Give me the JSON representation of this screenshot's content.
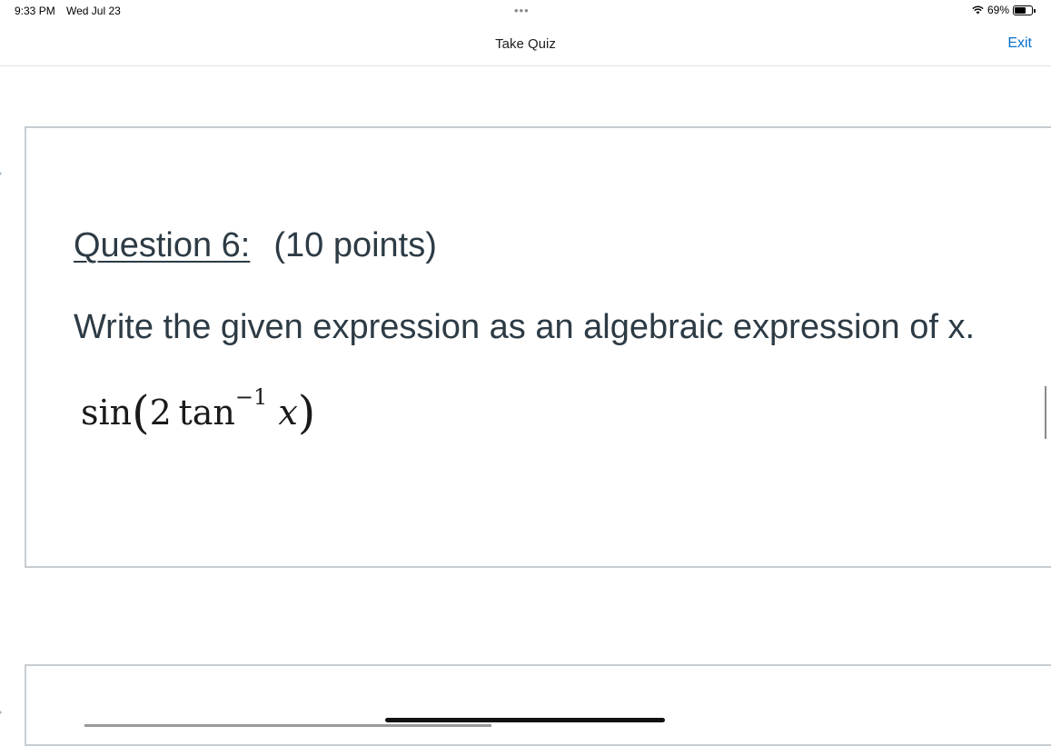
{
  "status_bar": {
    "time": "9:33 PM",
    "date": "Wed Jul 23",
    "battery": "69%",
    "battery_level": 0.69,
    "icons": [
      "wifi-icon",
      "battery-icon"
    ]
  },
  "nav": {
    "title": "Take Quiz",
    "exit_label": "Exit",
    "accent_color": "#0770cf"
  },
  "question": {
    "number_label": "Question 6:",
    "points_label": "(10 points)",
    "prompt": "Write the given expression as an algebraic expression of x.",
    "expression": {
      "func": "sin",
      "open": "(",
      "coef": "2",
      "inner_func": "tan",
      "exponent": "−1",
      "var": "x",
      "close": ")"
    }
  }
}
